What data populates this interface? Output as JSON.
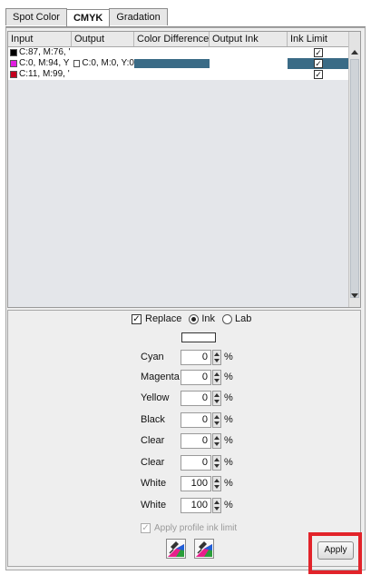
{
  "tabs": [
    {
      "label": "Spot Color"
    },
    {
      "label": "CMYK"
    },
    {
      "label": "Gradation"
    }
  ],
  "table": {
    "columns": [
      "Input",
      "Output",
      "Color Difference",
      "Output Ink",
      "Ink Limit"
    ],
    "rows": [
      {
        "swatch": "#000000",
        "input": "C:87, M:76, '",
        "output": "",
        "selected": false
      },
      {
        "swatch": "#e01ee0",
        "input": "C:0, M:94, Y",
        "output": "C:0, M:0, Y:0",
        "selected": true
      },
      {
        "swatch": "#c4001f",
        "input": "C:11, M:99, '",
        "output": "",
        "selected": false
      }
    ],
    "selection_color": "#3a6b86"
  },
  "mode": {
    "replace_label": "Replace",
    "ink_label": "Ink",
    "lab_label": "Lab"
  },
  "inks": [
    {
      "label": "Cyan",
      "value": "0"
    },
    {
      "label": "Magenta",
      "value": "0"
    },
    {
      "label": "Yellow",
      "value": "0"
    },
    {
      "label": "Black",
      "value": "0"
    },
    {
      "label": "Clear",
      "value": "0"
    },
    {
      "label": "Clear",
      "value": "0"
    },
    {
      "label": "White",
      "value": "100"
    },
    {
      "label": "White",
      "value": "100"
    }
  ],
  "percent": "%",
  "apply_profile_ink_limit": "Apply profile ink limit",
  "apply_label": "Apply",
  "icons": [
    "color-picker-icon",
    "color-picker-icon"
  ]
}
